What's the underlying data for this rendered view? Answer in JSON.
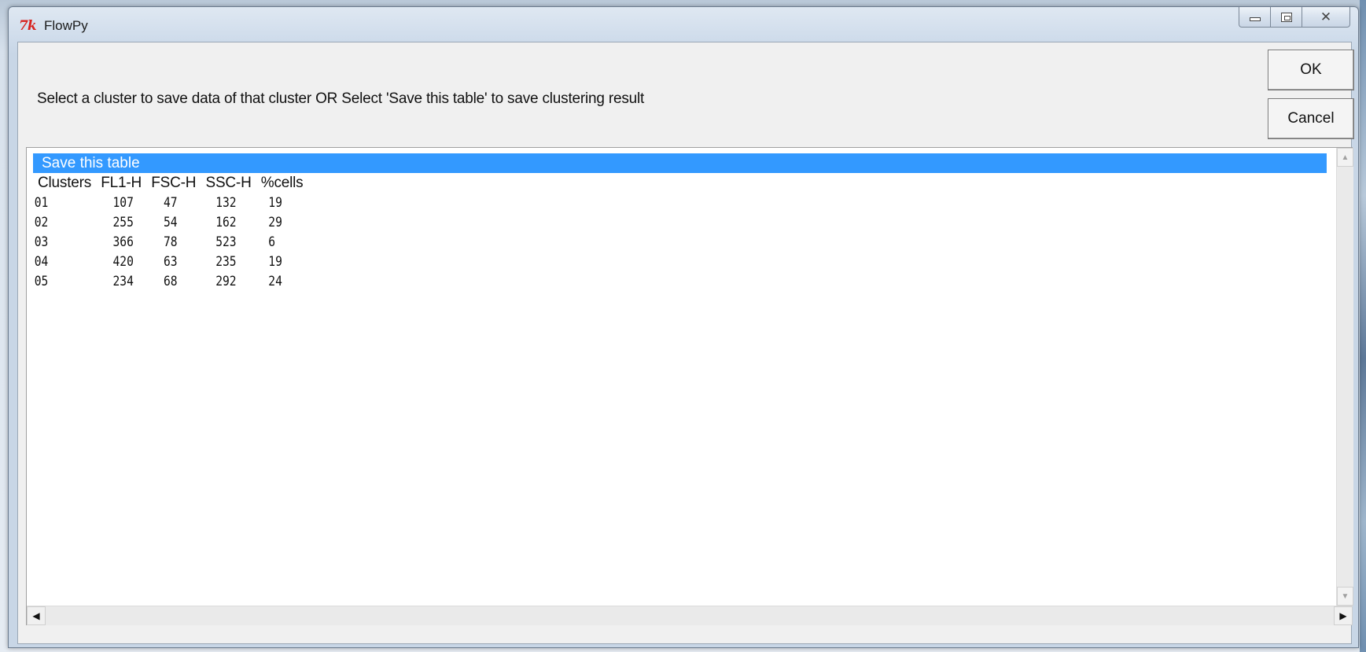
{
  "window": {
    "title": "FlowPy",
    "icon": "tk-feather-icon",
    "icon_text": "7k",
    "controls": [
      "minimize",
      "maximize",
      "close"
    ]
  },
  "dialog": {
    "message": "Select a cluster to save data of that cluster OR Select 'Save this table' to save clustering result",
    "ok_label": "OK",
    "cancel_label": "Cancel"
  },
  "list": {
    "selected_item": "Save this table",
    "header": [
      "Clusters",
      "FL1-H",
      "FSC-H",
      "SSC-H",
      "%cells"
    ],
    "rows": [
      [
        "01",
        "107",
        "47",
        "132",
        "19"
      ],
      [
        "02",
        "255",
        "54",
        "162",
        "29"
      ],
      [
        "03",
        "366",
        "78",
        "523",
        "6"
      ],
      [
        "04",
        "420",
        "63",
        "235",
        "19"
      ],
      [
        "05",
        "234",
        "68",
        "292",
        "24"
      ]
    ]
  },
  "colors": {
    "selection": "#3399ff",
    "dialog_bg": "#f0f0f0",
    "list_bg": "#ffffff"
  }
}
